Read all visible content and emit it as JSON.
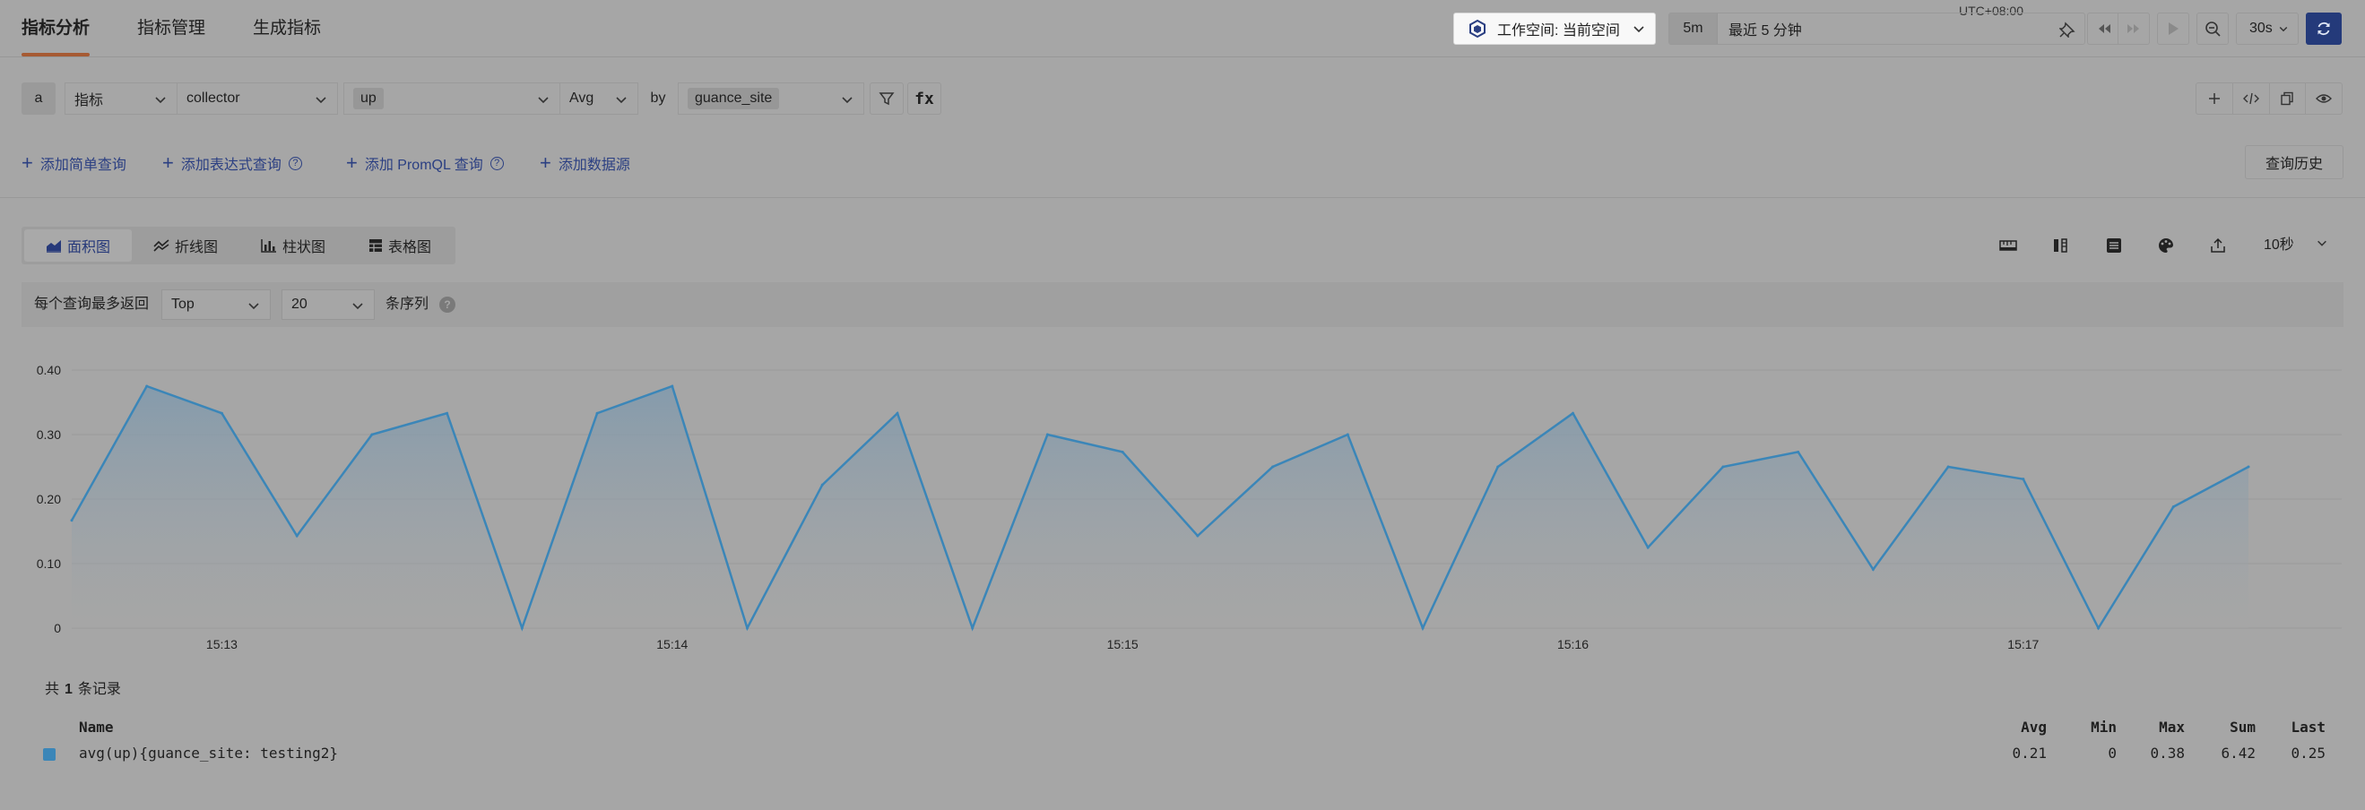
{
  "nav": {
    "tabs": [
      "指标分析",
      "指标管理",
      "生成指标"
    ],
    "active_tab": 0
  },
  "workspace": {
    "label": "工作空间: 当前空间"
  },
  "time": {
    "timezone": "UTC+08:00",
    "short": "5m",
    "range_label": "最近 5 分钟",
    "refresh_interval": "30s"
  },
  "query": {
    "label": "a",
    "source_type": "指标",
    "measurement": "collector",
    "field": "up",
    "aggregation": "Avg",
    "by_label": "by",
    "group_by": "guance_site",
    "fx_label": "fx"
  },
  "add_links": [
    "添加简单查询",
    "添加表达式查询",
    "添加 PromQL 查询",
    "添加数据源"
  ],
  "history_button": "查询历史",
  "chart_types": [
    "面积图",
    "折线图",
    "柱状图",
    "表格图"
  ],
  "active_chart_type": 0,
  "interval_label": "10秒",
  "return_row": {
    "label": "每个查询最多返回",
    "mode": "Top",
    "count": "20",
    "tail": "条序列"
  },
  "colors": {
    "series": "#3b86b8",
    "accent": "#243a7a",
    "tab_underline": "#a65a33"
  },
  "chart_data": {
    "type": "area",
    "x_ticks": [
      "15:13",
      "15:14",
      "15:15",
      "15:16",
      "15:17"
    ],
    "y_ticks": [
      "0",
      "0.10",
      "0.20",
      "0.30",
      "0.40"
    ],
    "ylim": [
      0,
      0.4
    ],
    "grid": true,
    "series": [
      {
        "name": "avg(up){guance_site: testing2}",
        "values": [
          0.167,
          0.375,
          0.333,
          0.143,
          0.3,
          0.333,
          0,
          0.333,
          0.375,
          0,
          0.222,
          0.333,
          0,
          0.3,
          0.273,
          0.143,
          0.25,
          0.3,
          0,
          0.25,
          0.333,
          0.125,
          0.25,
          0.273,
          0.091,
          0.25,
          0.231,
          0,
          0.188,
          0.25
        ]
      }
    ]
  },
  "legend": {
    "count_prefix": "共",
    "count": "1",
    "count_suffix": "条记录",
    "headers": [
      "Name",
      "Avg",
      "Min",
      "Max",
      "Sum",
      "Last"
    ],
    "rows": [
      {
        "name": "avg(up){guance_site: testing2}",
        "avg": "0.21",
        "min": "0",
        "max": "0.38",
        "sum": "6.42",
        "last": "0.25"
      }
    ]
  }
}
